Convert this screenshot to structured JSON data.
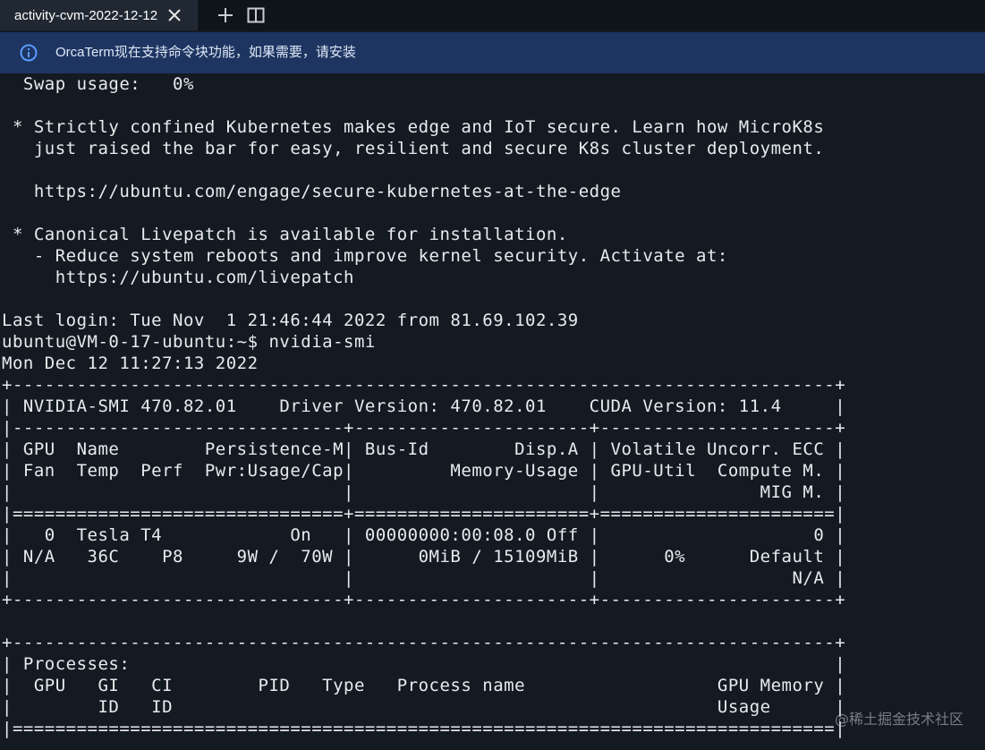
{
  "tabs": [
    {
      "label": "activity-cvm-2022-12-12",
      "active": true
    }
  ],
  "tabbar": {
    "close_icon": "close-icon",
    "new_tab_icon": "plus-icon",
    "split_icon": "split-pane-icon"
  },
  "notice": {
    "icon": "info-circle-icon",
    "text": "OrcaTerm现在支持命令块功能，如果需要，请安装"
  },
  "terminal": {
    "lines": [
      "  Swap usage:   0%",
      "",
      " * Strictly confined Kubernetes makes edge and IoT secure. Learn how MicroK8s",
      "   just raised the bar for easy, resilient and secure K8s cluster deployment.",
      "",
      "   https://ubuntu.com/engage/secure-kubernetes-at-the-edge",
      "",
      " * Canonical Livepatch is available for installation.",
      "   - Reduce system reboots and improve kernel security. Activate at:",
      "     https://ubuntu.com/livepatch",
      "",
      "Last login: Tue Nov  1 21:46:44 2022 from 81.69.102.39",
      "ubuntu@VM-0-17-ubuntu:~$ nvidia-smi",
      "Mon Dec 12 11:27:13 2022",
      "+-----------------------------------------------------------------------------+",
      "| NVIDIA-SMI 470.82.01    Driver Version: 470.82.01    CUDA Version: 11.4     |",
      "|-------------------------------+----------------------+----------------------+",
      "| GPU  Name        Persistence-M| Bus-Id        Disp.A | Volatile Uncorr. ECC |",
      "| Fan  Temp  Perf  Pwr:Usage/Cap|         Memory-Usage | GPU-Util  Compute M. |",
      "|                               |                      |               MIG M. |",
      "|===============================+======================+======================|",
      "|   0  Tesla T4            On   | 00000000:00:08.0 Off |                    0 |",
      "| N/A   36C    P8     9W /  70W |      0MiB / 15109MiB |      0%      Default |",
      "|                               |                      |                  N/A |",
      "+-------------------------------+----------------------+----------------------+",
      "",
      "+-----------------------------------------------------------------------------+",
      "| Processes:                                                                  |",
      "|  GPU   GI   CI        PID   Type   Process name                  GPU Memory |",
      "|        ID   ID                                                   Usage      |",
      "|=============================================================================|"
    ]
  },
  "watermark": "@稀土掘金技术社区"
}
